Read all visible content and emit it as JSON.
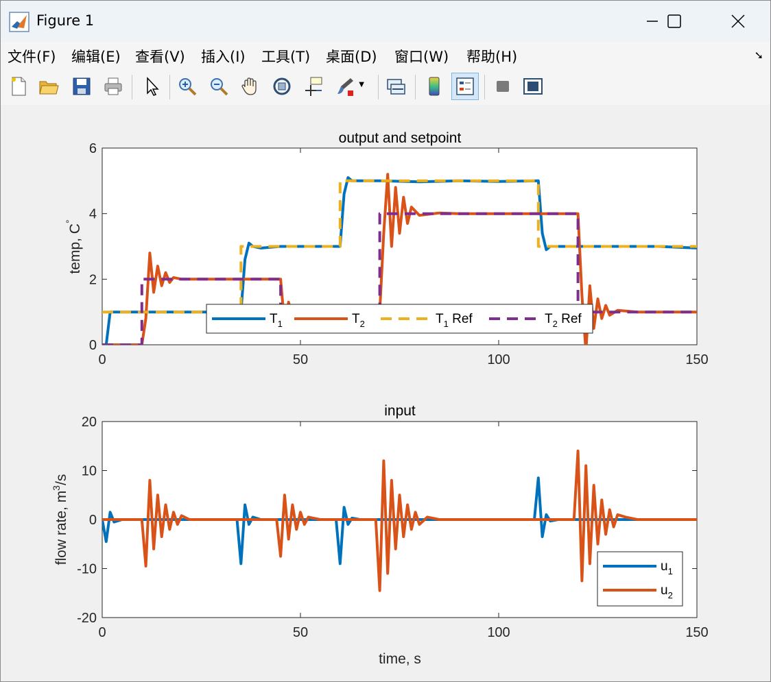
{
  "window": {
    "title": "Figure 1",
    "controls": {
      "minimize": "—",
      "maximize": "☐",
      "close": "✕"
    }
  },
  "menubar": {
    "items": [
      "文件(F)",
      "编辑(E)",
      "查看(V)",
      "插入(I)",
      "工具(T)",
      "桌面(D)",
      "窗口(W)",
      "帮助(H)"
    ],
    "overflow_icon": "dock-arrow-icon"
  },
  "toolbar": {
    "buttons": [
      {
        "icon": "new-figure-icon"
      },
      {
        "icon": "open-file-icon"
      },
      {
        "icon": "save-icon"
      },
      {
        "icon": "print-icon"
      },
      {
        "icon": "select-pointer-icon"
      },
      {
        "icon": "zoom-in-icon"
      },
      {
        "icon": "zoom-out-icon"
      },
      {
        "icon": "pan-hand-icon"
      },
      {
        "icon": "rotate-3d-icon"
      },
      {
        "icon": "data-cursor-icon"
      },
      {
        "icon": "brush-icon"
      },
      {
        "icon": "link-plot-icon"
      },
      {
        "icon": "colorbar-icon"
      },
      {
        "icon": "legend-icon"
      },
      {
        "icon": "hide-plot-tools-icon"
      },
      {
        "icon": "show-plot-tools-icon"
      }
    ]
  },
  "colors": {
    "T1": "#0072BD",
    "T2": "#D95319",
    "T1_ref": "#EDB120",
    "T2_ref": "#7E2F8E"
  },
  "chart_data": [
    {
      "type": "line",
      "title": "output and setpoint",
      "xlabel": "",
      "ylabel": "temp, C°",
      "xlim": [
        0,
        150
      ],
      "ylim": [
        0,
        6
      ],
      "xticks": [
        0,
        50,
        100,
        150
      ],
      "yticks": [
        0,
        2,
        4,
        6
      ],
      "legend": {
        "placement": "bottom-center",
        "orientation": "horizontal",
        "entries": [
          "T1",
          "T2",
          "T1 Ref",
          "T2 Ref"
        ]
      },
      "setpoint_changes": {
        "T1_ref": [
          [
            0,
            1
          ],
          [
            35,
            3
          ],
          [
            60,
            5
          ],
          [
            110,
            3
          ]
        ],
        "T2_ref": [
          [
            0,
            0
          ],
          [
            10,
            2
          ],
          [
            45,
            1
          ],
          [
            70,
            4
          ],
          [
            120,
            1
          ]
        ]
      },
      "series": [
        {
          "name": "T1",
          "style": "solid",
          "x": [
            0,
            1,
            2,
            5,
            10,
            20,
            30,
            35,
            36,
            37,
            38,
            40,
            45,
            50,
            55,
            60,
            61,
            62,
            63,
            65,
            70,
            80,
            90,
            100,
            110,
            111,
            112,
            113,
            115,
            120,
            130,
            140,
            150
          ],
          "y": [
            0,
            0,
            1,
            1,
            1,
            1,
            1,
            1,
            2.6,
            3.1,
            3.0,
            2.95,
            3,
            3,
            3,
            3,
            4.6,
            5.1,
            5.0,
            5,
            5,
            4.97,
            5,
            4.98,
            5,
            3.4,
            2.9,
            3.0,
            3,
            3,
            3,
            3,
            2.95
          ]
        },
        {
          "name": "T2",
          "style": "solid",
          "x": [
            0,
            5,
            10,
            11,
            12,
            13,
            14,
            15,
            16,
            17,
            18,
            20,
            25,
            30,
            40,
            45,
            46,
            47,
            48,
            49,
            50,
            55,
            60,
            65,
            70,
            71,
            72,
            73,
            74,
            75,
            76,
            77,
            78,
            80,
            85,
            90,
            100,
            110,
            120,
            121,
            122,
            123,
            124,
            125,
            126,
            127,
            128,
            130,
            135,
            140,
            150
          ],
          "y": [
            0,
            0,
            0,
            0.8,
            2.8,
            1.6,
            2.4,
            1.8,
            2.2,
            1.9,
            2.05,
            2,
            2,
            2,
            2,
            2,
            0.6,
            1.3,
            0.8,
            1.1,
            1,
            1,
            1,
            1,
            1,
            3.4,
            5.2,
            3.0,
            4.8,
            3.4,
            4.5,
            3.7,
            4.2,
            3.95,
            4.02,
            4,
            4,
            4,
            4,
            1.5,
            -0.2,
            1.8,
            0.5,
            1.4,
            0.8,
            1.2,
            0.9,
            1.05,
            1,
            1,
            1
          ]
        },
        {
          "name": "T1 Ref",
          "style": "dashed",
          "x": [
            0,
            35,
            35,
            60,
            60,
            110,
            110,
            150
          ],
          "y": [
            1,
            1,
            3,
            3,
            5,
            5,
            3,
            3
          ]
        },
        {
          "name": "T2 Ref",
          "style": "dashed",
          "x": [
            0,
            10,
            10,
            45,
            45,
            70,
            70,
            120,
            120,
            150
          ],
          "y": [
            0,
            0,
            2,
            2,
            1,
            1,
            4,
            4,
            1,
            1
          ]
        }
      ]
    },
    {
      "type": "line",
      "title": "input",
      "xlabel": "time, s",
      "ylabel": "flow rate, m³/s",
      "xlim": [
        0,
        150
      ],
      "ylim": [
        -20,
        20
      ],
      "xticks": [
        0,
        50,
        100,
        150
      ],
      "yticks": [
        -20,
        -10,
        0,
        10,
        20
      ],
      "legend": {
        "placement": "bottom-right",
        "orientation": "vertical",
        "entries": [
          "u1",
          "u2"
        ]
      },
      "series": [
        {
          "name": "u1",
          "x": [
            0,
            1,
            2,
            3,
            5,
            34,
            35,
            36,
            37,
            38,
            40,
            59,
            60,
            61,
            62,
            63,
            65,
            109,
            110,
            111,
            112,
            113,
            115,
            150
          ],
          "y": [
            0,
            -4.5,
            1.5,
            -0.5,
            0,
            0,
            -9,
            3,
            -1,
            0.5,
            0,
            0,
            -9,
            2.5,
            -1,
            0.3,
            0,
            0,
            8.5,
            -3.5,
            1,
            -0.3,
            0,
            0
          ]
        },
        {
          "name": "u2",
          "x": [
            0,
            10,
            11,
            12,
            13,
            14,
            15,
            16,
            17,
            18,
            19,
            20,
            22,
            44,
            45,
            46,
            47,
            48,
            49,
            50,
            51,
            52,
            55,
            69,
            70,
            71,
            72,
            73,
            74,
            75,
            76,
            77,
            78,
            79,
            80,
            82,
            85,
            119,
            120,
            121,
            122,
            123,
            124,
            125,
            126,
            127,
            128,
            129,
            130,
            132,
            135,
            150
          ],
          "y": [
            0,
            0,
            -9.5,
            8,
            -6,
            5,
            -3.5,
            3,
            -2,
            1.5,
            -1,
            0.8,
            0,
            0,
            -7.5,
            5,
            -4,
            3,
            -2,
            1.5,
            -1,
            0.5,
            0,
            0,
            -14.5,
            12,
            -11,
            8,
            -6,
            5,
            -3.5,
            3,
            -2,
            1.5,
            -1,
            0.5,
            0,
            0,
            14,
            -12.5,
            11,
            -9,
            7,
            -5,
            4,
            -3,
            2,
            -1.5,
            1,
            0.5,
            0,
            0
          ]
        }
      ]
    }
  ]
}
